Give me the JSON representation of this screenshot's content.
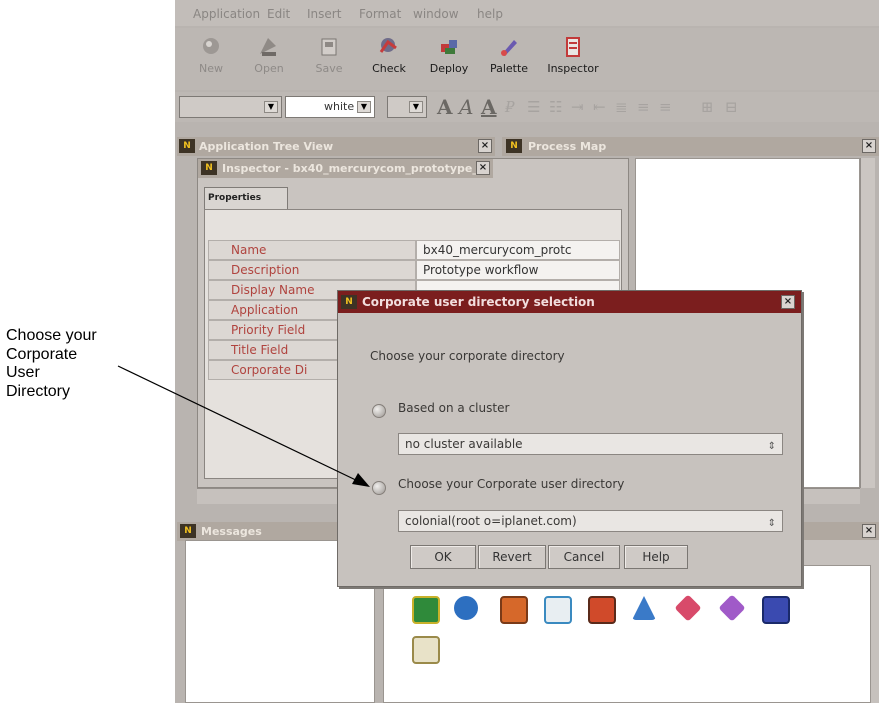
{
  "callout": {
    "lines": [
      "Choose your",
      "Corporate",
      "User",
      "Directory"
    ]
  },
  "menu": {
    "items": [
      "Application",
      "Edit",
      "Insert",
      "Format",
      "window",
      "help"
    ]
  },
  "toolbar": {
    "buttons": [
      {
        "label": "New",
        "icon": "new-icon",
        "enabled": false
      },
      {
        "label": "Open",
        "icon": "open-icon",
        "enabled": false
      },
      {
        "label": "Save",
        "icon": "save-icon",
        "enabled": false
      },
      {
        "label": "Check",
        "icon": "check-icon",
        "enabled": true
      },
      {
        "label": "Deploy",
        "icon": "deploy-icon",
        "enabled": true
      },
      {
        "label": "Palette",
        "icon": "palette-icon",
        "enabled": true
      },
      {
        "label": "Inspector",
        "icon": "inspector-icon",
        "enabled": true
      }
    ]
  },
  "format_bar": {
    "color_value": "white"
  },
  "panels": {
    "tree_view_title": "Application Tree View",
    "process_map_title": "Process Map",
    "messages_title": "Messages"
  },
  "inspector": {
    "title": "Inspector - bx40_mercurycom_prototype_",
    "tab": "Properties",
    "rows": [
      {
        "name": "Name",
        "value": "bx40_mercurycom_protc"
      },
      {
        "name": "Description",
        "value": "Prototype workflow"
      },
      {
        "name": "Display Name",
        "value": ""
      },
      {
        "name": "Application",
        "value": ""
      },
      {
        "name": "Priority Field",
        "value": ""
      },
      {
        "name": "Title Field",
        "value": ""
      },
      {
        "name": "Corporate Di",
        "value": ""
      }
    ]
  },
  "dialog": {
    "title": "Corporate user directory selection",
    "prompt": "Choose your corporate directory",
    "option_cluster": "Based on a cluster",
    "cluster_value": "no cluster available",
    "option_directory": "Choose your Corporate user directory",
    "directory_value": "colonial(root o=iplanet.com)",
    "buttons": {
      "ok": "OK",
      "revert": "Revert",
      "cancel": "Cancel",
      "help": "Help"
    }
  },
  "colors": {
    "dialog_title_bg": "#7b1e1e",
    "property_name": "#b0433e",
    "app_background": "#b9b4b0"
  }
}
